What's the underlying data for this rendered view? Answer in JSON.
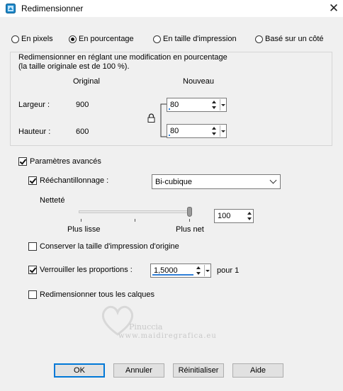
{
  "window": {
    "title": "Redimensionner",
    "close_label": "✕"
  },
  "mode_options": [
    {
      "label": "En pixels",
      "selected": false
    },
    {
      "label": "En pourcentage",
      "selected": true
    },
    {
      "label": "En taille d'impression",
      "selected": false
    },
    {
      "label": "Basé sur un côté",
      "selected": false
    }
  ],
  "group": {
    "description_line1": "Redimensionner en réglant une modification en pourcentage",
    "description_line2": "(la taille originale est de 100 %).",
    "col_original": "Original",
    "col_new": "Nouveau",
    "width_label": "Largeur :",
    "width_original": "900",
    "width_new": "80",
    "height_label": "Hauteur :",
    "height_original": "600",
    "height_new": "80",
    "lock_icon": "lock-icon"
  },
  "advanced": {
    "label": "Paramètres avancés",
    "checked": true,
    "resample_label": "Rééchantillonnage :",
    "resample_checked": true,
    "resample_method": "Bi-cubique",
    "sharpness_label": "Netteté",
    "sharpness_min_label": "Plus lisse",
    "sharpness_max_label": "Plus net",
    "sharpness_value": "100",
    "sharpness_fraction": 1.0,
    "keep_print_size_label": "Conserver la taille d'impression d'origine",
    "keep_print_size_checked": false,
    "lock_ratio_label": "Verrouiller les proportions :",
    "lock_ratio_checked": true,
    "ratio_value": "1,5000",
    "ratio_suffix": "pour 1",
    "resize_all_layers_label": "Redimensionner tous les calques",
    "resize_all_layers_checked": false
  },
  "watermark": {
    "line1": "Pinuccia",
    "line2": "www.maidiregrafica.eu"
  },
  "buttons": {
    "ok": "OK",
    "cancel": "Annuler",
    "reset": "Réinitialiser",
    "help": "Aide"
  },
  "colors": {
    "accent": "#0078d7",
    "field_bar": "#2f7fd8"
  }
}
